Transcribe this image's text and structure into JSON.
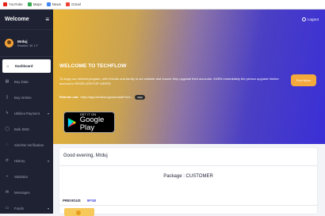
{
  "bookmarks": [
    {
      "label": "YouTube",
      "color": "#e62117"
    },
    {
      "label": "Maps",
      "color": "#34a853"
    },
    {
      "label": "News",
      "color": "#4285f4"
    },
    {
      "label": "Gmail",
      "color": "#ea4335"
    }
  ],
  "sidebar": {
    "title": "Welcome",
    "user": {
      "name": "Mrduj",
      "role": "Reseller: 3K 1 F"
    },
    "items": [
      {
        "label": "Dashboard",
        "icon": "home-icon",
        "glyph": "⌂"
      },
      {
        "label": "Buy Data",
        "icon": "data-icon",
        "glyph": "▤"
      },
      {
        "label": "Buy Airtime",
        "icon": "phone-icon",
        "glyph": "▯"
      },
      {
        "label": "Utilities Payment",
        "icon": "bolt-icon",
        "glyph": "ϟ"
      },
      {
        "label": "Bulk SMS",
        "icon": "chat-icon",
        "glyph": "◯"
      },
      {
        "label": "Sim/Nin Verification",
        "icon": "id-icon",
        "glyph": "◌"
      },
      {
        "label": "History",
        "icon": "history-icon",
        "glyph": "⟳"
      },
      {
        "label": "Statistics",
        "icon": "stats-icon",
        "glyph": "⌁"
      },
      {
        "label": "Messages",
        "icon": "mail-icon",
        "glyph": "✉"
      },
      {
        "label": "Funds",
        "icon": "wallet-icon",
        "glyph": "▭"
      }
    ]
  },
  "header": {
    "logout_label": "Logout"
  },
  "hero": {
    "heading": "WELCOME TO TECHFLOW",
    "text": "To enjoy our referral program, refer friends and family to our website and ensure they upgrade their accounts. EARN immediately the person upgrade his/her account to RESELLER/TOP USERS.",
    "referral_label": "Referral Link:",
    "referral_url": "https://app.techflow.ng/user/auth?ref=...",
    "copy_label": "copy",
    "find_label": "Find More",
    "store_small": "GET IT ON",
    "store_big": "Google Play"
  },
  "card": {
    "greeting": "Good evening, Mrduj",
    "package": "Package : CUSTOMER",
    "tabs": [
      "PREVIOUS",
      "9PSB"
    ]
  },
  "colors": {
    "sidebar": "#1f2233",
    "accent": "#4b4fd9",
    "button": "#f4a93d"
  }
}
